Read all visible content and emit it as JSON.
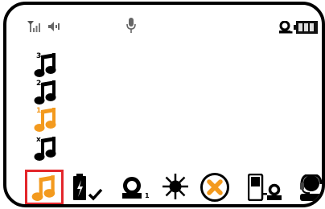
{
  "status_bar": {
    "signal_icon": "signal-bars-icon",
    "speaker_icon": "speaker-icon",
    "mic_icon": "microphone-icon",
    "user_icon": "user-presence-icon",
    "battery_icon": "battery-icon"
  },
  "ringtone_list": {
    "items": [
      {
        "priority": "3",
        "icon": "music-note-icon",
        "color": "#000000",
        "selected": false
      },
      {
        "priority": "2",
        "icon": "music-note-icon",
        "color": "#000000",
        "selected": false
      },
      {
        "priority": "1",
        "icon": "music-note-icon",
        "color": "#f39a1e",
        "selected": true
      },
      {
        "priority": "x",
        "icon": "music-note-icon",
        "color": "#000000",
        "selected": false
      }
    ]
  },
  "bottom_bar": {
    "items": [
      {
        "icon": "music-note-icon",
        "color": "#f39a1e",
        "selected": true
      },
      {
        "icon": "battery-charging-check-icon",
        "selected": false
      },
      {
        "icon": "user-sub-icon",
        "sub_label": "1",
        "selected": false
      },
      {
        "icon": "brightness-icon",
        "selected": false
      },
      {
        "icon": "cancel-x-icon",
        "color": "#f39a1e",
        "selected": false
      },
      {
        "icon": "phone-user-icon",
        "selected": false
      },
      {
        "icon": "headset-user-icon",
        "selected": false
      }
    ],
    "selection_box_color": "#e3262b"
  },
  "colors": {
    "accent": "#f39a1e",
    "selection": "#e3262b",
    "frame": "#000000"
  }
}
